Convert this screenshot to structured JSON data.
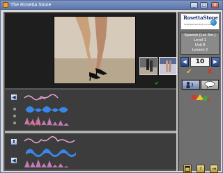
{
  "window": {
    "title": "The Rosetta Stone",
    "minimize_label": "_",
    "maximize_label": "□",
    "close_label": "x"
  },
  "logo": {
    "brand": "RosettaStone",
    "tagline": "language learning success"
  },
  "lesson_info": {
    "language": "Spanish (Lat. Am.)",
    "level": "Level 1",
    "unit": "Unit 8",
    "lesson": "Lesson 2"
  },
  "navigation": {
    "prev_icon": "triangle-left-icon",
    "next_icon": "triangle-right-icon",
    "prev_glyph": "◀",
    "next_glyph": "▶",
    "current_number": "10"
  },
  "marks": {
    "correct_glyph": "✔",
    "wrong_glyph": "✘"
  },
  "tracks": {
    "top_button_glyph": "◀",
    "bottom_record_glyph": "⬆",
    "bottom_play_glyph": "◀"
  },
  "footer_buttons": {
    "help_glyph": "?",
    "exit_glyph": "⇥"
  },
  "colors": {
    "accent": "#2f4b8a",
    "wave_blue": "#3a86e8",
    "wave_pink": "#e7a6d8",
    "check_green": "#2fbf2f"
  }
}
